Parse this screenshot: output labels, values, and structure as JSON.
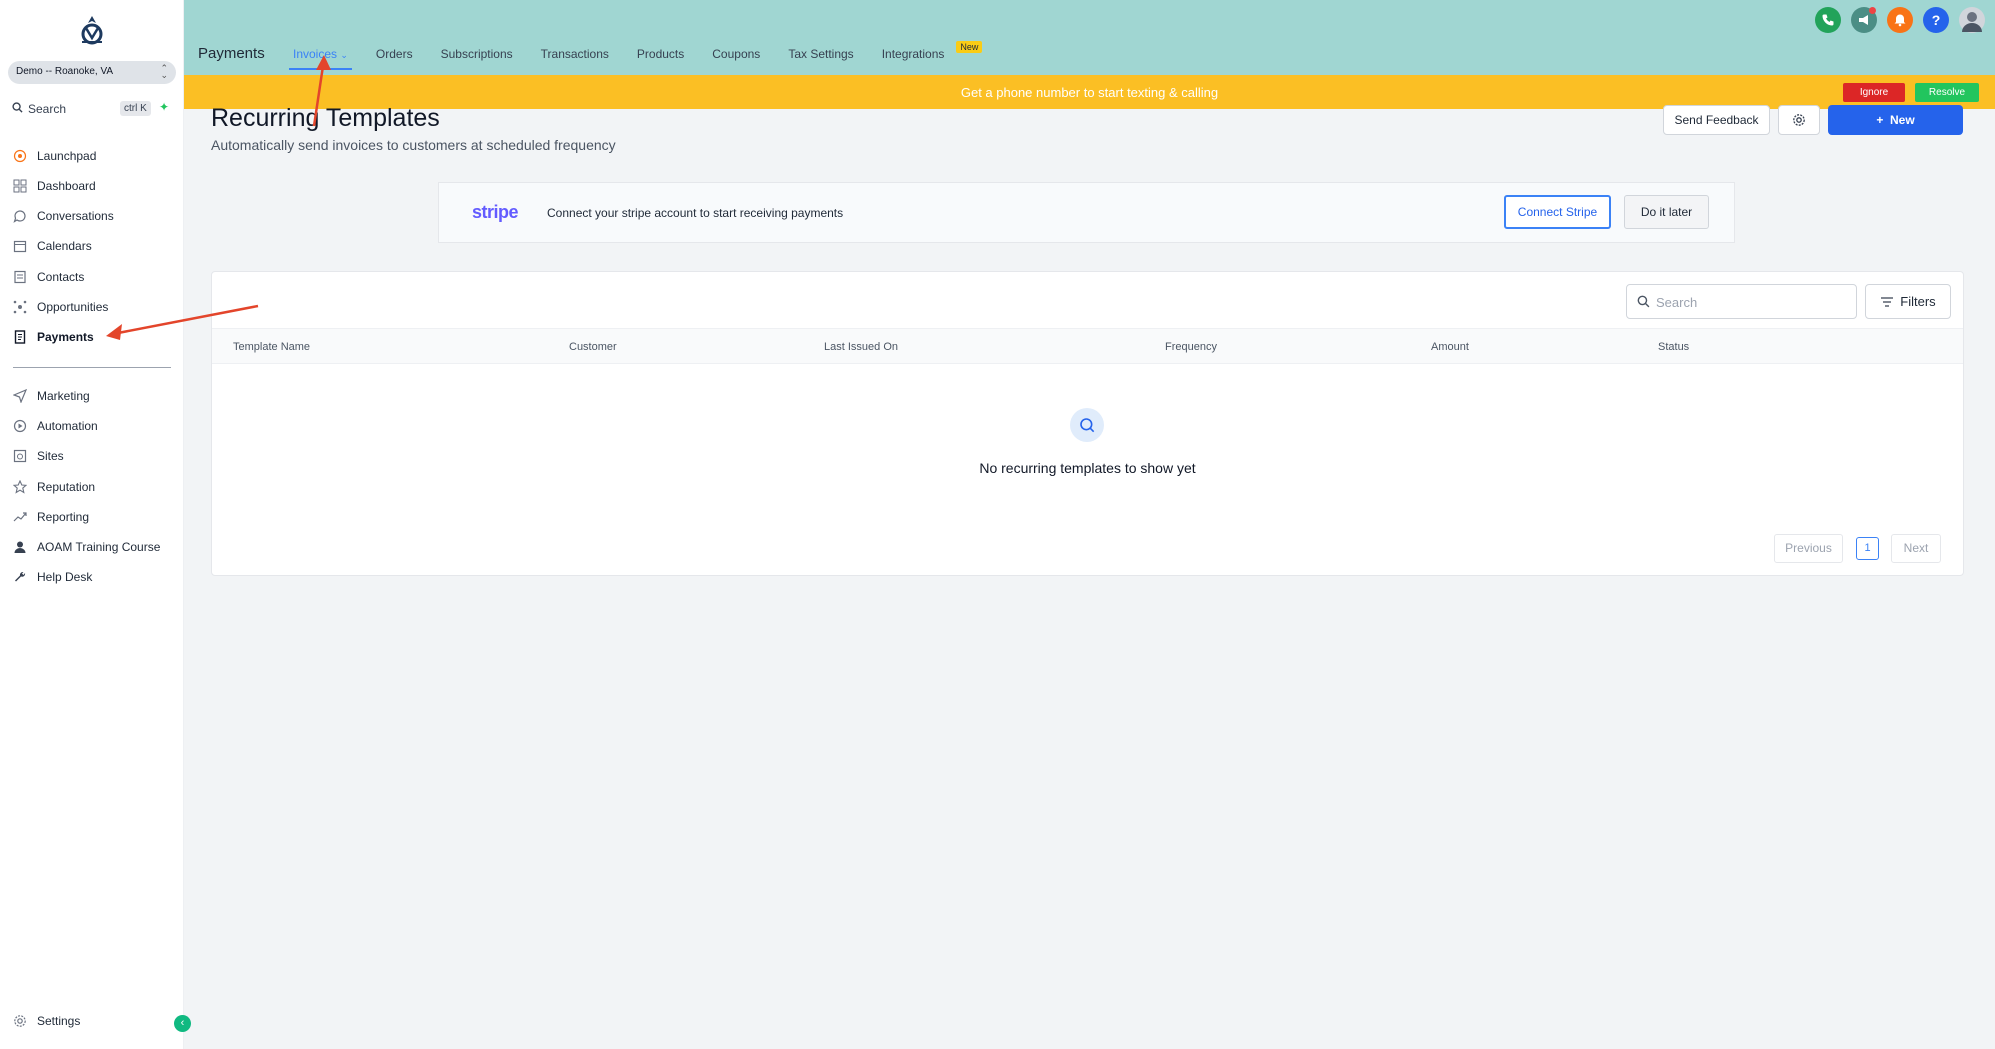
{
  "sidebar": {
    "location": "Demo -- Roanoke, VA",
    "search_label": "Search",
    "search_shortcut": "ctrl K",
    "items": [
      {
        "label": "Launchpad",
        "icon": "rocket-icon"
      },
      {
        "label": "Dashboard",
        "icon": "grid-icon"
      },
      {
        "label": "Conversations",
        "icon": "chat-icon"
      },
      {
        "label": "Calendars",
        "icon": "calendar-icon"
      },
      {
        "label": "Contacts",
        "icon": "contacts-icon"
      },
      {
        "label": "Opportunities",
        "icon": "network-icon"
      },
      {
        "label": "Payments",
        "icon": "receipt-icon"
      },
      {
        "label": "Marketing",
        "icon": "send-icon"
      },
      {
        "label": "Automation",
        "icon": "automation-icon"
      },
      {
        "label": "Sites",
        "icon": "sites-icon"
      },
      {
        "label": "Reputation",
        "icon": "star-icon"
      },
      {
        "label": "Reporting",
        "icon": "trend-icon"
      },
      {
        "label": "AOAM Training Course",
        "icon": "user-icon"
      },
      {
        "label": "Help Desk",
        "icon": "wrench-icon"
      }
    ],
    "settings_label": "Settings"
  },
  "header": {
    "section_title": "Payments",
    "tabs": [
      {
        "label": "Invoices"
      },
      {
        "label": "Orders"
      },
      {
        "label": "Subscriptions"
      },
      {
        "label": "Transactions"
      },
      {
        "label": "Products"
      },
      {
        "label": "Coupons"
      },
      {
        "label": "Tax Settings"
      },
      {
        "label": "Integrations"
      }
    ],
    "new_badge": "New",
    "icon_colors": {
      "phone": "#22a35a",
      "megaphone": "#4b8e85",
      "bell": "#f97316",
      "help": "#2563eb"
    }
  },
  "banner": {
    "message": "Get a phone number to start texting & calling",
    "ignore_label": "Ignore",
    "resolve_label": "Resolve"
  },
  "page": {
    "title": "Recurring Templates",
    "subtitle": "Automatically send invoices to customers at scheduled frequency",
    "feedback_label": "Send Feedback",
    "new_label": "New"
  },
  "stripe": {
    "logo_text": "stripe",
    "message": "Connect your stripe account to start receiving payments",
    "connect_label": "Connect Stripe",
    "later_label": "Do it later"
  },
  "table": {
    "search_placeholder": "Search",
    "filters_label": "Filters",
    "columns": [
      "Template Name",
      "Customer",
      "Last Issued On",
      "Frequency",
      "Amount",
      "Status"
    ],
    "empty_message": "No recurring templates to show yet",
    "pagination": {
      "prev": "Previous",
      "page": "1",
      "next": "Next"
    }
  }
}
